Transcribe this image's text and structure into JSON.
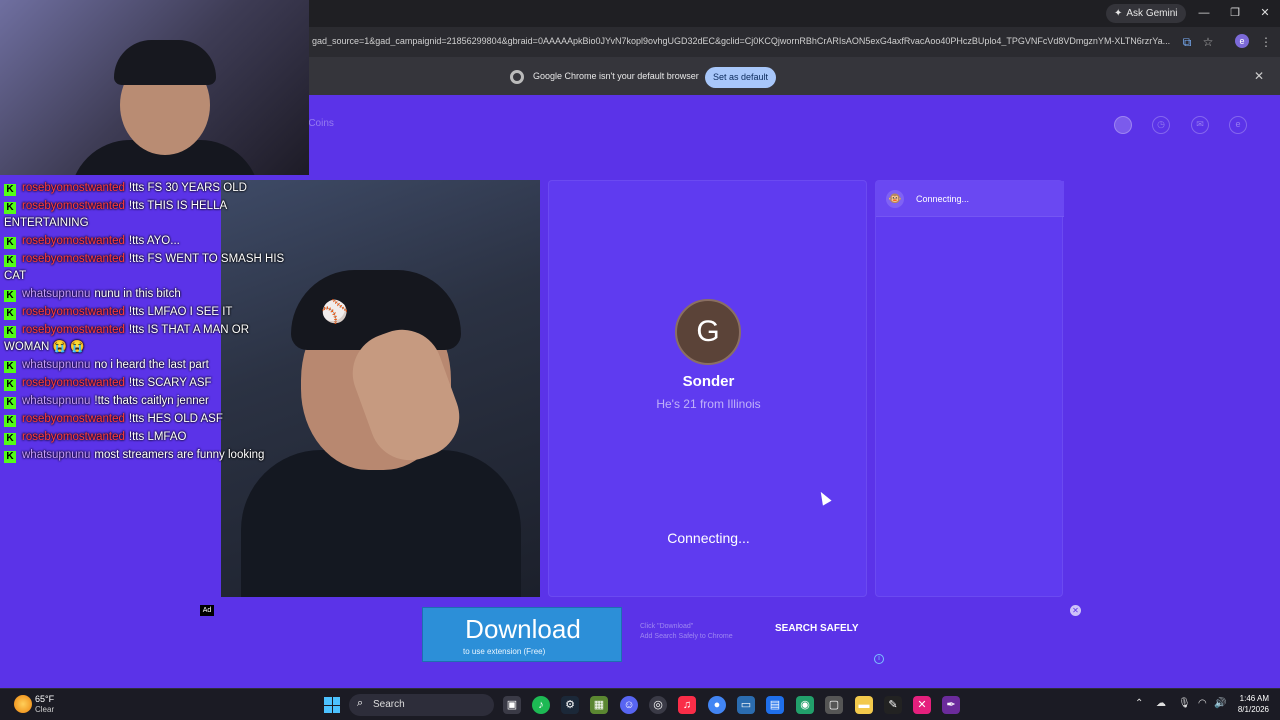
{
  "browser": {
    "ask_gemini": "Ask Gemini",
    "url": "gad_source=1&gad_campaignid=21856299804&gbraid=0AAAAApkBio0JYvN7kopl9ovhgUGD32dEC&gclid=Cj0KCQjwornRBhCrARIsAON5exG4axfRvacAoo40PHczBUplo4_TPGVNFcVd8VDmgznYM-XLTN6rzrYa...",
    "infobar_text": "Google Chrome isn't your default browser",
    "set_default_label": "Set as default",
    "profile_initial": "e"
  },
  "site": {
    "coins_label": "e Coins",
    "header_initial": "e",
    "peer": {
      "avatar_initial": "G",
      "name": "Sonder",
      "info": "He's 21 from Illinois"
    },
    "status_main": "Connecting...",
    "chat_status": "Connecting...",
    "chat_avatar_emoji": "🐵"
  },
  "overlay_chat": [
    {
      "user": "rosebyomostwanted",
      "color": "red",
      "message": "!tts FS 30 YEARS OLD"
    },
    {
      "user": "rosebyomostwanted",
      "color": "red",
      "message": "!tts THIS IS HELLA ENTERTAINING"
    },
    {
      "user": "rosebyomostwanted",
      "color": "red",
      "message": "!tts AYO..."
    },
    {
      "user": "rosebyomostwanted",
      "color": "red",
      "message": "!tts FS WENT TO SMASH HIS CAT"
    },
    {
      "user": "whatsupnunu",
      "color": "purple",
      "message": "nunu in this bitch"
    },
    {
      "user": "rosebyomostwanted",
      "color": "red",
      "message": "!tts LMFAO I SEE IT"
    },
    {
      "user": "rosebyomostwanted",
      "color": "red",
      "message": "!tts IS THAT A MAN OR WOMAN 😭 😭"
    },
    {
      "user": "whatsupnunu",
      "color": "purple",
      "message": "no i heard the last part"
    },
    {
      "user": "rosebyomostwanted",
      "color": "red",
      "message": "!tts SCARY ASF"
    },
    {
      "user": "whatsupnunu",
      "color": "purple",
      "message": "!tts thats caitlyn jenner"
    },
    {
      "user": "rosebyomostwanted",
      "color": "red",
      "message": "!tts HES OLD ASF"
    },
    {
      "user": "rosebyomostwanted",
      "color": "red",
      "message": "!tts LMFAO"
    },
    {
      "user": "whatsupnunu",
      "color": "purple",
      "message": "most streamers are funny looking"
    }
  ],
  "ad": {
    "label": "Ad",
    "download_title": "Download",
    "download_sub": "to use extension (Free)",
    "step1": "Click \"Download\"",
    "step2": "Add Search Safely to Chrome",
    "brand": "SEARCH SAFELY"
  },
  "taskbar": {
    "temperature": "65°F",
    "condition": "Clear",
    "search_label": "Search",
    "time": "1:46 AM",
    "date": "8/1/2026"
  },
  "colors": {
    "site_background": "#5b33e8",
    "username_red": "#ff3b3b",
    "username_purple": "#c79bff",
    "kick_badge": "#53fc18",
    "download_button": "#2c8fd8"
  }
}
